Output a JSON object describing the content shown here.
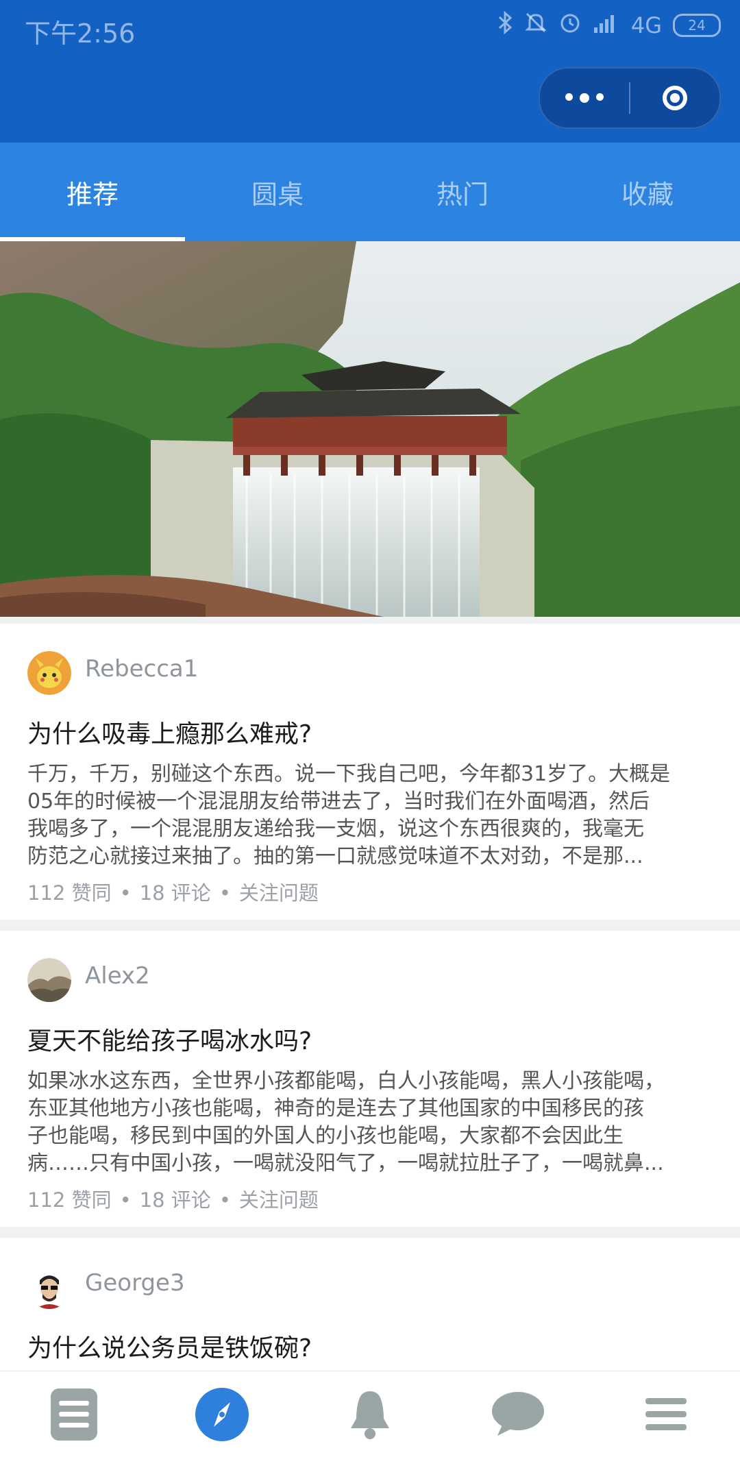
{
  "status_bar": {
    "time": "下午2:56",
    "network": "4G",
    "battery": "24"
  },
  "header": {
    "capsule_more_icon": "more-dots-icon",
    "capsule_close_icon": "target-circle-icon"
  },
  "tabs": [
    {
      "label": "推荐",
      "active": true
    },
    {
      "label": "圆桌",
      "active": false
    },
    {
      "label": "热门",
      "active": false
    },
    {
      "label": "收藏",
      "active": false
    }
  ],
  "banner": {
    "description": ""
  },
  "feed": [
    {
      "author": "Rebecca1",
      "title": "为什么吸毒上瘾那么难戒?",
      "excerpt_lines": [
        "千万，千万，别碰这个东西。说一下我自己吧，今年都31岁了。大概是",
        "05年的时候被一个混混朋友给带进去了，当时我们在外面喝酒，然后",
        "我喝多了，一个混混朋友递给我一支烟，说这个东西很爽的，我毫无",
        "防范之心就接过来抽了。抽的第一口就感觉味道不太对劲，不是那..."
      ],
      "likes": "112 赞同",
      "comments": "18 评论",
      "follow": "关注问题"
    },
    {
      "author": "Alex2",
      "title": "夏天不能给孩子喝冰水吗?",
      "excerpt_lines": [
        "如果冰水这东西，全世界小孩都能喝，白人小孩能喝，黑人小孩能喝，",
        "东亚其他地方小孩也能喝，神奇的是连去了其他国家的中国移民的孩",
        "子也能喝，移民到中国的外国人的小孩也能喝，大家都不会因此生",
        "病……只有中国小孩，一喝就没阳气了，一喝就拉肚子了，一喝就鼻..."
      ],
      "likes": "112 赞同",
      "comments": "18 评论",
      "follow": "关注问题"
    },
    {
      "author": "George3",
      "title": "为什么说公务员是铁饭碗?"
    }
  ],
  "bottom_nav": [
    {
      "icon": "document-list-icon",
      "active": false
    },
    {
      "icon": "compass-icon",
      "active": true
    },
    {
      "icon": "bell-icon",
      "active": false
    },
    {
      "icon": "chat-bubble-icon",
      "active": false
    },
    {
      "icon": "menu-icon",
      "active": false
    }
  ],
  "colors": {
    "header": "#1461c4",
    "tabs": "#2c84e0",
    "accent": "#2f7fdc",
    "nav_inactive": "#9aa6a6"
  }
}
